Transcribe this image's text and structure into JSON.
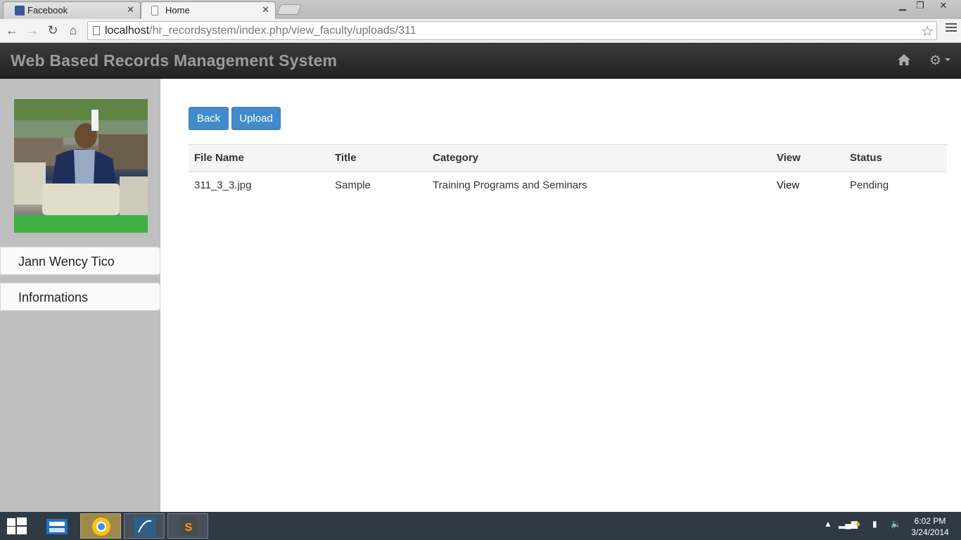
{
  "browser": {
    "tabs": [
      {
        "label": "Facebook",
        "favicon_color": "#3b5998"
      },
      {
        "label": "Home",
        "active": true
      }
    ],
    "url_host": "localhost",
    "url_path": "/hr_recordsystem/index.php/view_faculty/uploads/311"
  },
  "app": {
    "title": "Web Based Records Management System"
  },
  "sidebar": {
    "user_name": "Jann Wency Tico",
    "items": [
      {
        "label": "Informations"
      }
    ]
  },
  "actions": {
    "back_label": "Back",
    "upload_label": "Upload"
  },
  "table": {
    "columns": [
      "File Name",
      "Title",
      "Category",
      "View",
      "Status"
    ],
    "rows": [
      {
        "file_name": "311_3_3.jpg",
        "title": "Sample",
        "category": "Training Programs and Seminars",
        "view": "View",
        "status": "Pending"
      }
    ]
  },
  "taskbar": {
    "time": "6:02 PM",
    "date": "3/24/2014"
  },
  "colors": {
    "primary_button": "#428bca",
    "navbar": "#2b2b2b",
    "sidebar": "#bfbfbf"
  }
}
